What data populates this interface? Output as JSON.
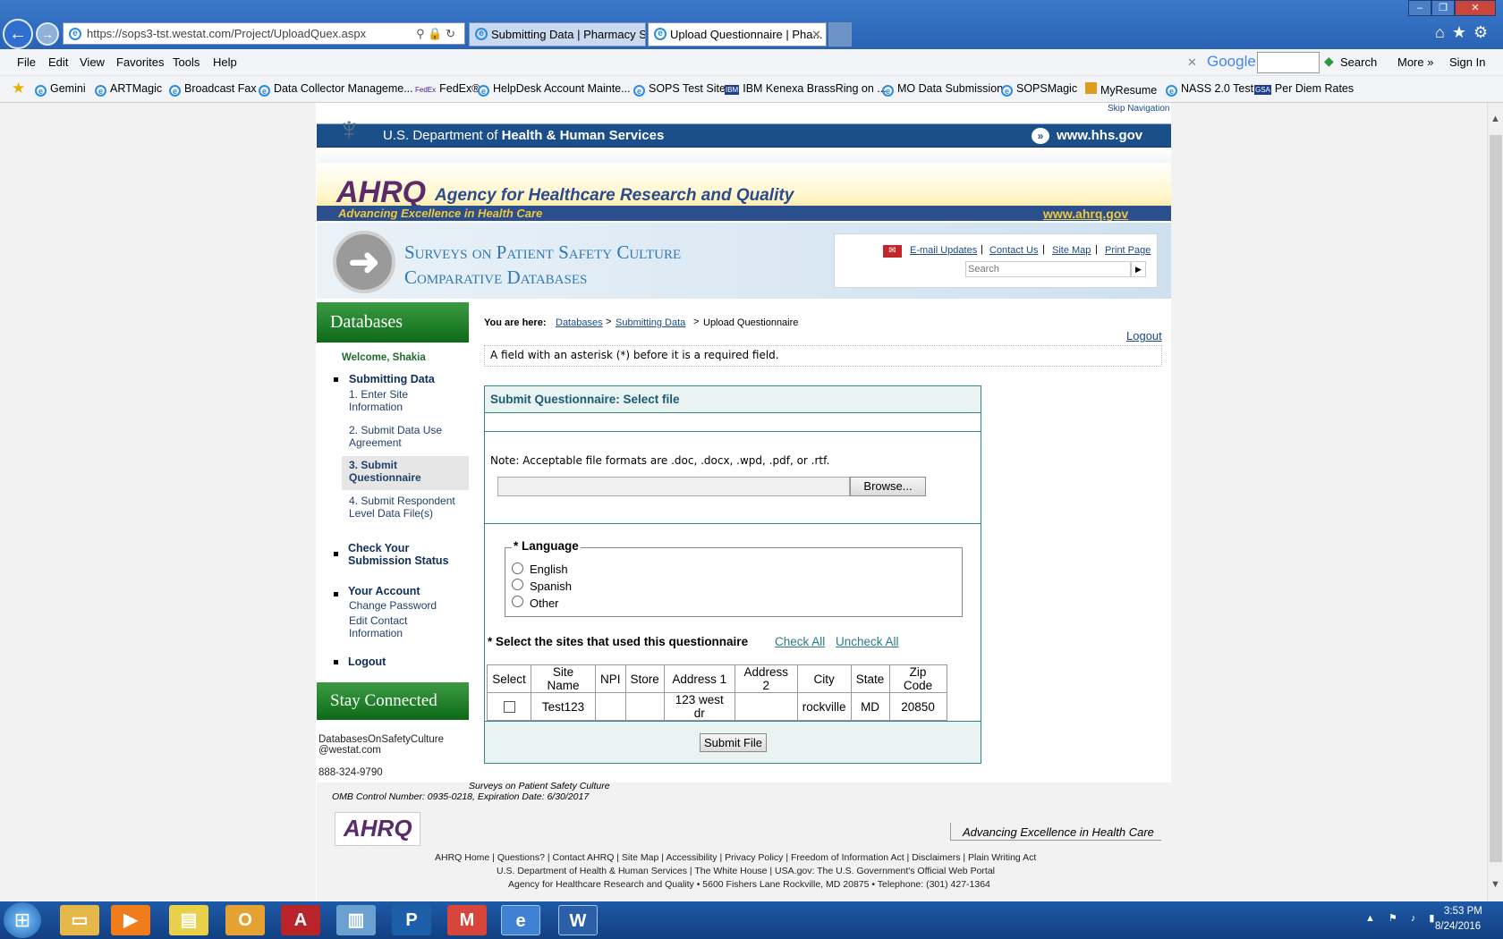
{
  "browser": {
    "url": "https://sops3-tst.westat.com/Project/UploadQuex.aspx",
    "tabs": [
      {
        "label": "Submitting Data | Pharmacy S..."
      },
      {
        "label": "Upload Questionnaire | Pha..."
      }
    ],
    "menu": [
      "File",
      "Edit",
      "View",
      "Favorites",
      "Tools",
      "Help"
    ],
    "toolbar": {
      "google_label": "Google",
      "search_label": "Search",
      "more_label": "More »",
      "signin_label": "Sign In"
    },
    "favorites": [
      "Gemini",
      "ARTMagic",
      "Broadcast Fax",
      "Data Collector Manageme...",
      "FedEx®",
      "HelpDesk Account Mainte...",
      "SOPS Test Site",
      "IBM Kenexa BrassRing on ...",
      "MO Data Submission",
      "SOPSMagic",
      "MyResume",
      "NASS 2.0 Test",
      "Per Diem Rates"
    ]
  },
  "site": {
    "skip_nav": "Skip Navigation",
    "hhs_title_pre": "U.S. Department of ",
    "hhs_title_bold": "Health & Human Services",
    "hhs_url": "www.hhs.gov",
    "ahrq_logo": "AHRQ",
    "ahrq_name": "Agency for Healthcare Research and Quality",
    "ahrq_tagline": "Advancing Excellence in Health Care",
    "ahrq_url": "www.ahrq.gov",
    "sops_title1": "Surveys on Patient Safety Culture",
    "sops_title2": "Comparative Databases",
    "tools": {
      "email": "E-mail Updates",
      "contact": "Contact Us",
      "sitemap": "Site Map",
      "print": "Print Page",
      "search_placeholder": "Search"
    }
  },
  "sidebar": {
    "title": "Databases",
    "welcome": "Welcome, Shakia",
    "submitting_data": "Submitting Data",
    "steps": [
      "1. Enter Site Information",
      "2. Submit Data Use Agreement",
      "3. Submit Questionnaire",
      "4. Submit Respondent Level Data File(s)"
    ],
    "check_status": "Check Your Submission Status",
    "your_account": "Your Account",
    "change_password": "Change Password",
    "edit_contact": "Edit Contact Information",
    "logout": "Logout",
    "stay_connected": "Stay Connected",
    "email1": "DatabasesOnSafetyCulture",
    "email2": "@westat.com",
    "phone": "888-324-9790"
  },
  "main": {
    "you_are_here": "You are here:",
    "crumb1": "Databases",
    "crumb2": "Submitting Data",
    "crumb3": "Upload Questionnaire",
    "logout": "Logout",
    "required_note": "A field with an asterisk (*) before it is a required field.",
    "panel_title": "Submit Questionnaire: Select file",
    "file_note": "Note: Acceptable file formats are .doc, .docx, .wpd, .pdf, or .rtf.",
    "browse": "Browse...",
    "language_legend": "* Language",
    "languages": [
      "English",
      "Spanish",
      "Other"
    ],
    "sites_label": "* Select the sites that used this questionnaire",
    "check_all": "Check All",
    "uncheck_all": "Uncheck All",
    "columns": [
      "Select",
      "Site Name",
      "NPI",
      "Store",
      "Address 1",
      "Address 2",
      "City",
      "State",
      "Zip Code"
    ],
    "row": {
      "site_name": "Test123",
      "npi": "",
      "store": "",
      "address1": "123 west dr",
      "address2": "",
      "city": "rockville",
      "state": "MD",
      "zip": "20850"
    },
    "submit": "Submit File"
  },
  "footer": {
    "sops": "Surveys on Patient Safety Culture",
    "omb": "OMB Control Number: 0935-0218, Expiration Date: 6/30/2017",
    "logo": "AHRQ",
    "tagline": "Advancing Excellence in Health Care",
    "links1": "AHRQ Home  |  Questions?  |  Contact AHRQ  |  Site Map  |  Accessibility  |  Privacy Policy  |  Freedom of Information Act  |  Disclaimers  |  Plain Writing Act",
    "links2": "U.S. Department of Health & Human Services  |  The White House  |  USA.gov: The U.S. Government's Official Web Portal",
    "address": "Agency for Healthcare Research and Quality • 5600 Fishers Lane Rockville, MD 20875 • Telephone: (301) 427-1364"
  },
  "taskbar": {
    "time": "3:53 PM",
    "date": "8/24/2016"
  }
}
